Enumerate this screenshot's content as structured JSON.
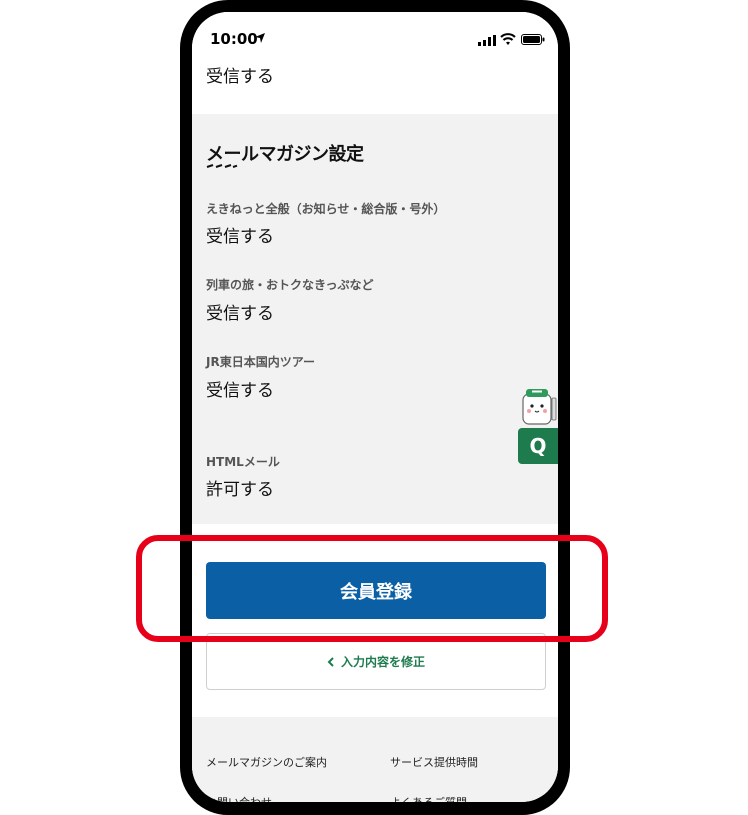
{
  "status_bar": {
    "time": "10:00"
  },
  "top": {
    "value": "受信する"
  },
  "mail_magazine": {
    "title": "メールマガジン設定",
    "items": [
      {
        "label": "えきねっと全般（お知らせ・総合版・号外）",
        "value": "受信する"
      },
      {
        "label": "列車の旅・おトクなきっぷなど",
        "value": "受信する"
      },
      {
        "label": "JR東日本国内ツアー",
        "value": "受信する"
      },
      {
        "label": "HTMLメール",
        "value": "許可する"
      }
    ]
  },
  "qa_widget": {
    "label": "Q"
  },
  "actions": {
    "register_label": "会員登録",
    "edit_label": "入力内容を修正"
  },
  "footer": {
    "links": [
      "メールマガジンのご案内",
      "サービス提供時間",
      "お問い合わせ",
      "よくあるご質問"
    ]
  },
  "colors": {
    "primary_button": "#0a5fa5",
    "accent_green": "#1e7b4e",
    "highlight_red": "#e6001a",
    "section_bg": "#f2f2f2"
  }
}
